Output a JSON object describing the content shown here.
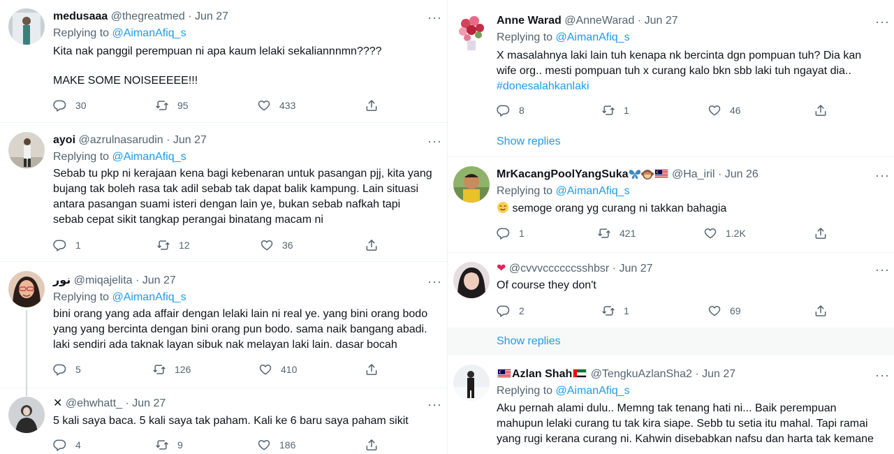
{
  "left": {
    "t1": {
      "name": "medusaaa",
      "handle": "@thegreatmed",
      "dot": "·",
      "date": "Jun 27",
      "replying_prefix": "Replying to ",
      "replying_mention": "@AimanAfiq_s",
      "text1": "Kita nak panggil perempuan ni apa kaum lelaki sekaliannnmn????",
      "text2": "MAKE SOME NOISEEEEE!!!",
      "replies": "30",
      "retweets": "95",
      "likes": "433"
    },
    "t2": {
      "name": "ayoi",
      "handle": "@azrulnasarudin",
      "dot": "·",
      "date": "Jun 27",
      "replying_prefix": "Replying to ",
      "replying_mention": "@AimanAfiq_s",
      "text": "Sebab tu pkp ni kerajaan kena bagi kebenaran untuk pasangan pjj, kita yang\nbujang tak boleh rasa tak adil sebab tak dapat balik kampung. Lain situasi\nantara pasangan suami isteri dengan lain ye, bukan sebab nafkah tapi\nsebab cepat sikit tangkap perangai binatang macam ni",
      "replies": "1",
      "retweets": "12",
      "likes": "36"
    },
    "t3": {
      "name": "نور",
      "handle": "@miqajelita",
      "dot": "·",
      "date": "Jun 27",
      "replying_prefix": "Replying to ",
      "replying_mention": "@AimanAfiq_s",
      "text": "bini orang yang ada affair dengan lelaki lain ni real ye. yang bini orang bodo\nyang yang bercinta dengan bini orang pun bodo. sama naik bangang abadi.\nlaki sendiri ada taknak layan sibuk nak melayan laki lain. dasar bocah",
      "replies": "5",
      "retweets": "126",
      "likes": "410"
    },
    "t4": {
      "name": "✕",
      "handle": "@ehwhatt_",
      "dot": "·",
      "date": "Jun 27",
      "text": "5 kali saya baca. 5 kali saya tak paham. Kali ke 6 baru saya paham sikit",
      "replies": "4",
      "retweets": "9",
      "likes": "186"
    }
  },
  "right": {
    "t1": {
      "name": "Anne Warad",
      "handle": "@AnneWarad",
      "dot": "·",
      "date": "Jun 27",
      "replying_prefix": "Replying to ",
      "replying_mention": "@AimanAfiq_s",
      "text": "X masalahnya laki lain tuh kenapa nk bercinta dgn pompuan tuh? Dia kan\nwife org.. mesti pompuan tuh x curang kalo bkn sbb laki tuh ngayat dia..",
      "hashtag": "#donesalahkanlaki",
      "replies": "8",
      "retweets": "1",
      "likes": "46",
      "show_replies": "Show replies"
    },
    "t2": {
      "name": "MrKacangPoolYangSuka",
      "handle": "@Ha_iril",
      "dot": "·",
      "date": "Jun 26",
      "replying_prefix": "Replying to ",
      "replying_mention": "@AimanAfiq_s",
      "text": "semoge orang yg curang ni takkan bahagia",
      "replies": "1",
      "retweets": "421",
      "likes": "1.2K"
    },
    "t3": {
      "name": "❤",
      "handle": "@cvvvccccccsshbsr",
      "dot": "·",
      "date": "Jun 27",
      "text": "Of course they don't",
      "replies": "2",
      "retweets": "1",
      "likes": "69",
      "show_replies": "Show replies"
    },
    "t4": {
      "name": "Azlan Shah",
      "handle": "@TengkuAzlanSha2",
      "dot": "·",
      "date": "Jun 27",
      "replying_prefix": "Replying to ",
      "replying_mention": "@AimanAfiq_s",
      "text": "Aku pernah alami dulu.. Memng tak tenang hati ni... Baik perempuan\nmahupun lelaki curang tu tak kira siape. Sebb tu setia itu mahal. Tapi ramai\nyang rugi kerana curang ni. Kahwin disebabkan nafsu dan harta tak kemane"
    }
  },
  "more_label": "···",
  "colors": {
    "accent": "#1d9bf0",
    "secondary": "#536471",
    "text": "#0f1419",
    "border": "#eff3f4"
  }
}
